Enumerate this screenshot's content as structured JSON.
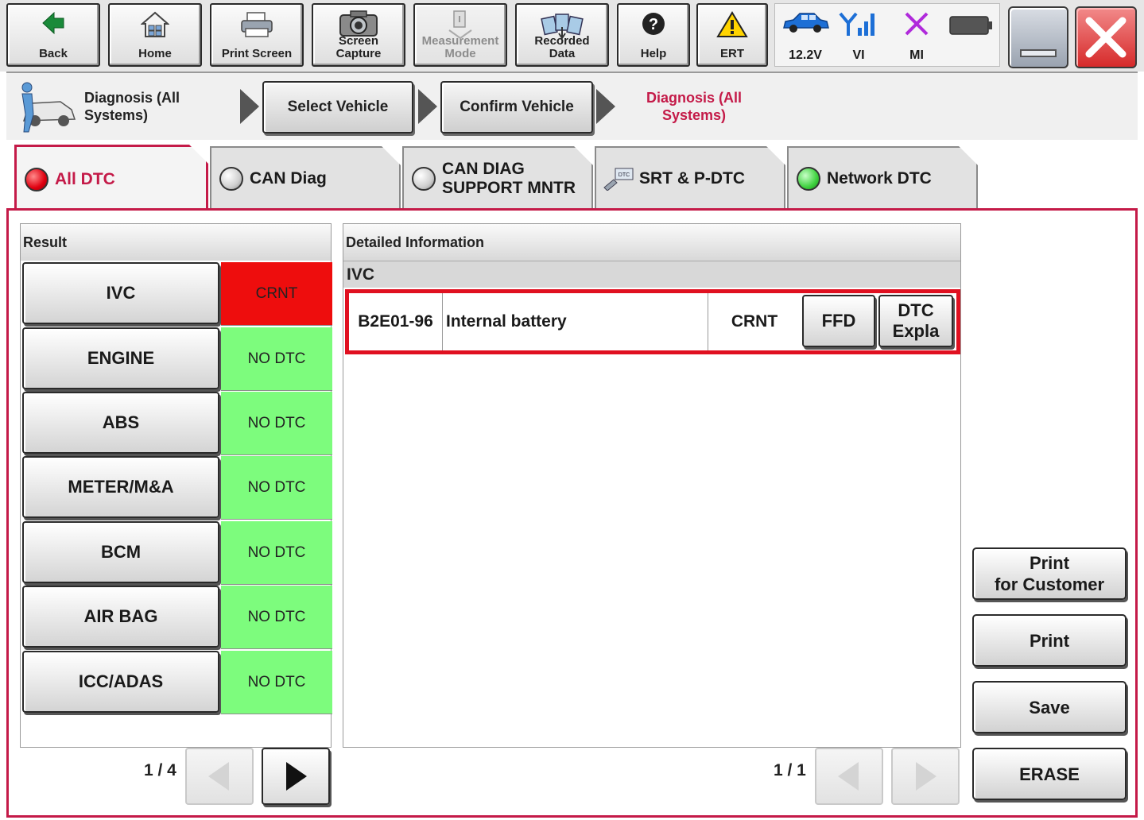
{
  "toolbar": {
    "back": "Back",
    "home": "Home",
    "print_screen": "Print Screen",
    "screen_capture": "Screen\nCapture",
    "measurement_mode": "Measurement\nMode",
    "recorded_data": "Recorded\nData",
    "help": "Help",
    "ert": "ERT"
  },
  "status": {
    "voltage": "12.2V",
    "vi": "VI",
    "mi": "MI"
  },
  "breadcrumb": {
    "step1": "Diagnosis (All\nSystems)",
    "select_vehicle": "Select Vehicle",
    "confirm_vehicle": "Confirm Vehicle",
    "current": "Diagnosis (All\nSystems)"
  },
  "tabs": [
    {
      "label": "All DTC",
      "led": "#e00010"
    },
    {
      "label": "CAN Diag",
      "led": "#cfcfcf"
    },
    {
      "label": "CAN DIAG\nSUPPORT MNTR",
      "led": "#cfcfcf"
    },
    {
      "label": "SRT & P-DTC",
      "icon": "dtc-tool-icon"
    },
    {
      "label": "Network DTC",
      "led": "#3fd23f"
    }
  ],
  "result": {
    "header": "Result",
    "rows": [
      {
        "system": "IVC",
        "status": "CRNT"
      },
      {
        "system": "ENGINE",
        "status": "NO DTC"
      },
      {
        "system": "ABS",
        "status": "NO DTC"
      },
      {
        "system": "METER/M&A",
        "status": "NO DTC"
      },
      {
        "system": "BCM",
        "status": "NO DTC"
      },
      {
        "system": "AIR BAG",
        "status": "NO DTC"
      },
      {
        "system": "ICC/ADAS",
        "status": "NO DTC"
      }
    ],
    "page": "1 / 4"
  },
  "detail": {
    "header": "Detailed Information",
    "system": "IVC",
    "dtc": {
      "code": "B2E01-96",
      "description": "Internal battery",
      "status": "CRNT",
      "ffd_label": "FFD",
      "expl_label": "DTC\nExpla"
    },
    "page": "1 / 1"
  },
  "actions": {
    "print_customer": "Print\nfor Customer",
    "print": "Print",
    "save": "Save",
    "erase": "ERASE"
  },
  "colors": {
    "accent": "#c41a48",
    "crnt": "#ee0d0d",
    "no_dtc": "#7dfc7d",
    "dtc_row_border": "#e01020"
  }
}
